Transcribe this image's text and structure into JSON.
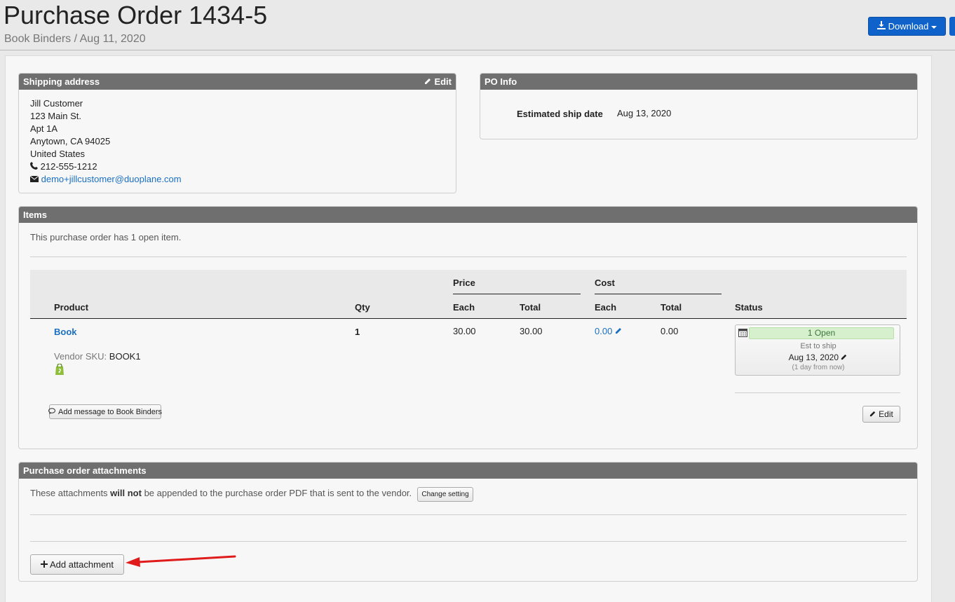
{
  "header": {
    "title": "Purchase Order 1434-5",
    "subtitle": "Book Binders / Aug 11, 2020",
    "download_label": "Download"
  },
  "shipping": {
    "title": "Shipping address",
    "edit_label": "Edit",
    "name": "Jill Customer",
    "street": "123 Main St.",
    "apt": "Apt 1A",
    "city": "Anytown, CA 94025",
    "country": "United States",
    "phone": "212-555-1212",
    "email": "demo+jillcustomer@duoplane.com"
  },
  "po_info": {
    "title": "PO Info",
    "ship_date_label": "Estimated ship date",
    "ship_date_value": "Aug 13, 2020"
  },
  "items": {
    "title": "Items",
    "summary": "This purchase order has 1 open item.",
    "headers": {
      "price": "Price",
      "cost": "Cost",
      "product": "Product",
      "qty": "Qty",
      "price_each": "Each",
      "price_total": "Total",
      "cost_each": "Each",
      "cost_total": "Total",
      "status": "Status"
    },
    "rows": [
      {
        "product": "Book",
        "vendor_sku_label": "Vendor SKU:",
        "vendor_sku": "BOOK1",
        "qty": "1",
        "price_each": "30.00",
        "price_total": "30.00",
        "cost_each": "0.00",
        "cost_total": "0.00",
        "status_badge": "1 Open",
        "est_label": "Est to ship",
        "est_date": "Aug 13, 2020",
        "est_relative": "(1 day from now)"
      }
    ],
    "message_button": "Add message to Book Binders",
    "edit_button": "Edit"
  },
  "attachments": {
    "title": "Purchase order attachments",
    "notice_pre": "These attachments ",
    "notice_bold": "will not",
    "notice_post": " be appended to the purchase order PDF that is sent to the vendor.",
    "change_setting": "Change setting",
    "add_attachment": "Add attachment"
  },
  "colors": {
    "primary": "#0e62c9",
    "panel_header": "#6f6f6f",
    "link": "#1a6fc2",
    "open_badge": "#d6efcd",
    "arrow": "#e01b1b"
  }
}
